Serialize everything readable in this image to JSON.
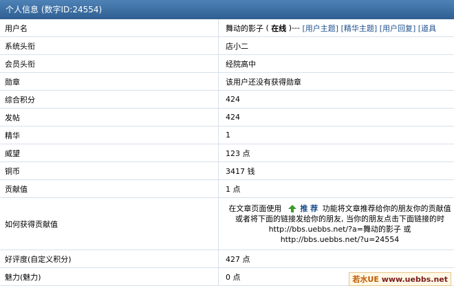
{
  "title": "个人信息 (数字ID:24554)",
  "rows": [
    {
      "label": "用户名"
    },
    {
      "label": "系统头衔",
      "value": "店小二"
    },
    {
      "label": "会员头衔",
      "value": "经院高中"
    },
    {
      "label": "勋章",
      "value": "该用户还没有获得勋章"
    },
    {
      "label": "综合积分",
      "value": "424"
    },
    {
      "label": "发帖",
      "value": "424"
    },
    {
      "label": "精华",
      "value": "1"
    },
    {
      "label": "威望",
      "value": "123 点"
    },
    {
      "label": "铜币",
      "value": "3417 钱"
    },
    {
      "label": "贡献值",
      "value": "1 点"
    },
    {
      "label": "如何获得贡献值"
    },
    {
      "label": "好评度(自定义积分)",
      "value": "427 点"
    },
    {
      "label": "魅力(魅力)",
      "value": "0 点"
    }
  ],
  "username": {
    "name": "舞动的影子",
    "open_paren": " ( ",
    "status": "在线",
    "close_paren": " )--- ",
    "links": [
      "[用户主题]",
      "[精华主题]",
      "[用户回复]",
      "[道具"
    ]
  },
  "contribution": {
    "line1_prefix": "在文章页面使用",
    "recommend": "推 荐",
    "line1_suffix": "功能将文章推荐给你的朋友你的贡献值",
    "line2": "或者将下面的链接发给你的朋友, 当你的朋友点击下面链接的时",
    "line3": "http://bbs.uebbs.net/?a=舞动的影子 或",
    "line4": "http://bbs.uebbs.net/?u=24554"
  },
  "watermark": {
    "brand": "若水UE",
    "url": "www.uebbs.net"
  },
  "colors": {
    "header": "#3a6a9c",
    "link": "#1d4f8c",
    "recommend_icon": "#3a9a2e"
  }
}
